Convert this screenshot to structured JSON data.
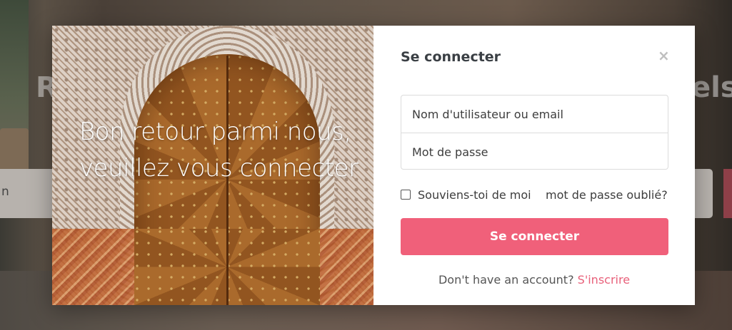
{
  "background": {
    "hero_left_fragment": "R",
    "hero_right_fragment": "els",
    "search_fragment": "n"
  },
  "modal": {
    "welcome_text": "Bon retour parmi nous, veuillez vous connecter",
    "title": "Se connecter",
    "close_symbol": "×",
    "username_placeholder": "Nom d'utilisateur ou email",
    "password_placeholder": "Mot de passe",
    "remember_label": "Souviens-toi de moi",
    "remember_checked": false,
    "forgot_label": "mot de passe oublié?",
    "submit_label": "Se connecter",
    "signup_prompt": "Don't have an account?",
    "signup_link": "S'inscrire"
  },
  "colors": {
    "accent": "#f0607a",
    "link": "#e8607a",
    "title": "#3a3f44"
  },
  "icons": {
    "close": "close-icon",
    "checkbox": "checkbox-icon"
  }
}
